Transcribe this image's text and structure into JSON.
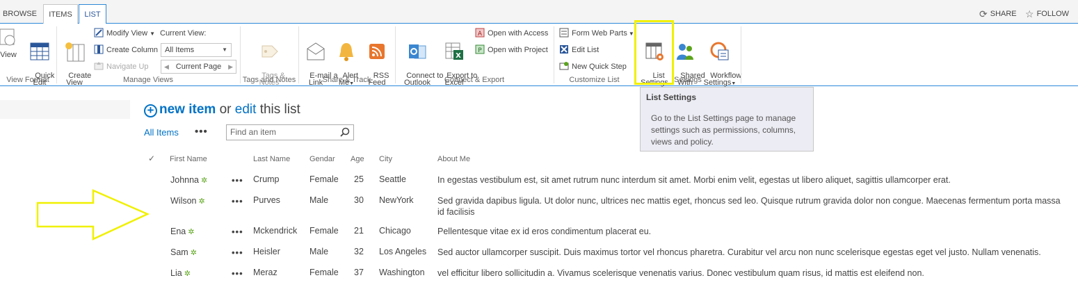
{
  "tabs": {
    "browse": "BROWSE",
    "items": "ITEMS",
    "list": "LIST"
  },
  "topright": {
    "share": "SHARE",
    "follow": "FOLLOW"
  },
  "ribbon": {
    "view_format": {
      "view": "View",
      "quick_edit": "Quick\nEdit",
      "label": "View Format"
    },
    "manage_views": {
      "create_view": "Create\nView",
      "modify_view": "Modify View",
      "create_column": "Create Column",
      "navigate_up": "Navigate Up",
      "current_view_label": "Current View:",
      "current_view_value": "All Items",
      "current_page": "Current Page",
      "label": "Manage Views"
    },
    "tags_notes": {
      "tags_notes": "Tags &\nNotes",
      "label": "Tags and Notes"
    },
    "share_track": {
      "email_link": "E-mail a\nLink",
      "alert_me": "Alert\nMe",
      "rss_feed": "RSS\nFeed",
      "label": "Share & Track"
    },
    "connect_export": {
      "connect_outlook": "Connect to\nOutlook",
      "export_excel": "Export to\nExcel",
      "open_access": "Open with Access",
      "open_project": "Open with Project",
      "label": "Connect & Export"
    },
    "customize_list": {
      "form_web_parts": "Form Web Parts",
      "edit_list": "Edit List",
      "new_quick_step": "New Quick Step",
      "label": "Customize List"
    },
    "settings": {
      "list_settings": "List\nSettings",
      "shared_with": "Shared\nWith",
      "workflow_settings": "Workflow\nSettings",
      "label": "Settings"
    }
  },
  "tooltip": {
    "title": "List Settings",
    "body": "Go to the List Settings page to manage settings such as permissions, columns, views and policy."
  },
  "main": {
    "new_item": "new item",
    "or": "or",
    "edit": "edit",
    "this_list": "this list",
    "all_items": "All Items",
    "more": "•••",
    "search_placeholder": "Find an item"
  },
  "columns": [
    "First Name",
    "Last Name",
    "Gendar",
    "Age",
    "City",
    "About Me"
  ],
  "rows": [
    {
      "first": "Johnna",
      "last": "Crump",
      "gender": "Female",
      "age": "25",
      "city": "Seattle",
      "about": "In egestas vestibulum est, sit amet rutrum nunc interdum sit amet. Morbi enim velit, egestas ut libero aliquet, sagittis ullamcorper erat."
    },
    {
      "first": "Wilson",
      "last": "Purves",
      "gender": "Male",
      "age": "30",
      "city": "NewYork",
      "about": "Sed gravida dapibus ligula. Ut dolor nunc, ultrices nec mattis eget, rhoncus sed leo. Quisque rutrum gravida dolor non congue. Maecenas fermentum porta massa id facilisis"
    },
    {
      "first": "Ena",
      "last": "Mckendrick",
      "gender": "Female",
      "age": "21",
      "city": "Chicago",
      "about": "Pellentesque vitae ex id eros condimentum placerat eu."
    },
    {
      "first": "Sam",
      "last": "Heisler",
      "gender": "Male",
      "age": "32",
      "city": "Los Angeles",
      "about": "Sed auctor ullamcorper suscipit. Duis maximus tortor vel rhoncus pharetra. Curabitur vel arcu non nunc scelerisque egestas eget vel justo. Nullam venenatis."
    },
    {
      "first": "Lia",
      "last": "Meraz",
      "gender": "Female",
      "age": "37",
      "city": "Washington",
      "about": "vel efficitur libero sollicitudin a. Vivamus scelerisque venenatis varius. Donec vestibulum quam risus, id mattis est eleifend non."
    }
  ],
  "row_dots": "•••",
  "new_marker": "✲",
  "colors": {
    "accent": "#0072c6",
    "highlight": "#f0f000",
    "new_marker": "#5ba41c"
  }
}
